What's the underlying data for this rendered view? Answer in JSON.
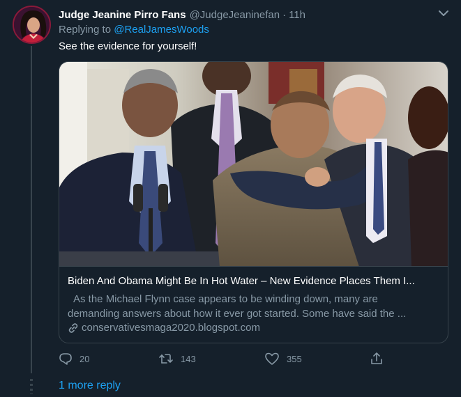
{
  "tweet": {
    "display_name": "Judge Jeanine Pirro Fans",
    "handle": "@JudgeJeaninefan",
    "separator": "·",
    "time": "11h",
    "replying_to_label": "Replying to",
    "replying_to_handle": "@RealJamesWoods",
    "text": "See the evidence for yourself!"
  },
  "card": {
    "title": "Biden And Obama Might Be In Hot Water – New Evidence Places Them I...",
    "description_line1": "As the Michael Flynn case appears to be winding down, many are",
    "description_line2": "demanding answers about how it ever got started. Some have said the ...",
    "domain": "conservativesmaga2020.blogspot.com"
  },
  "actions": {
    "reply_count": "20",
    "retweet_count": "143",
    "like_count": "355"
  },
  "thread": {
    "more_replies_label": "1 more reply"
  },
  "colors": {
    "background": "#15202b",
    "secondary_text": "#8899a6",
    "accent": "#1da1f2",
    "border": "#38444d"
  },
  "icons": [
    "chevron-down-icon",
    "link-icon",
    "reply-icon",
    "retweet-icon",
    "like-icon",
    "share-icon"
  ]
}
